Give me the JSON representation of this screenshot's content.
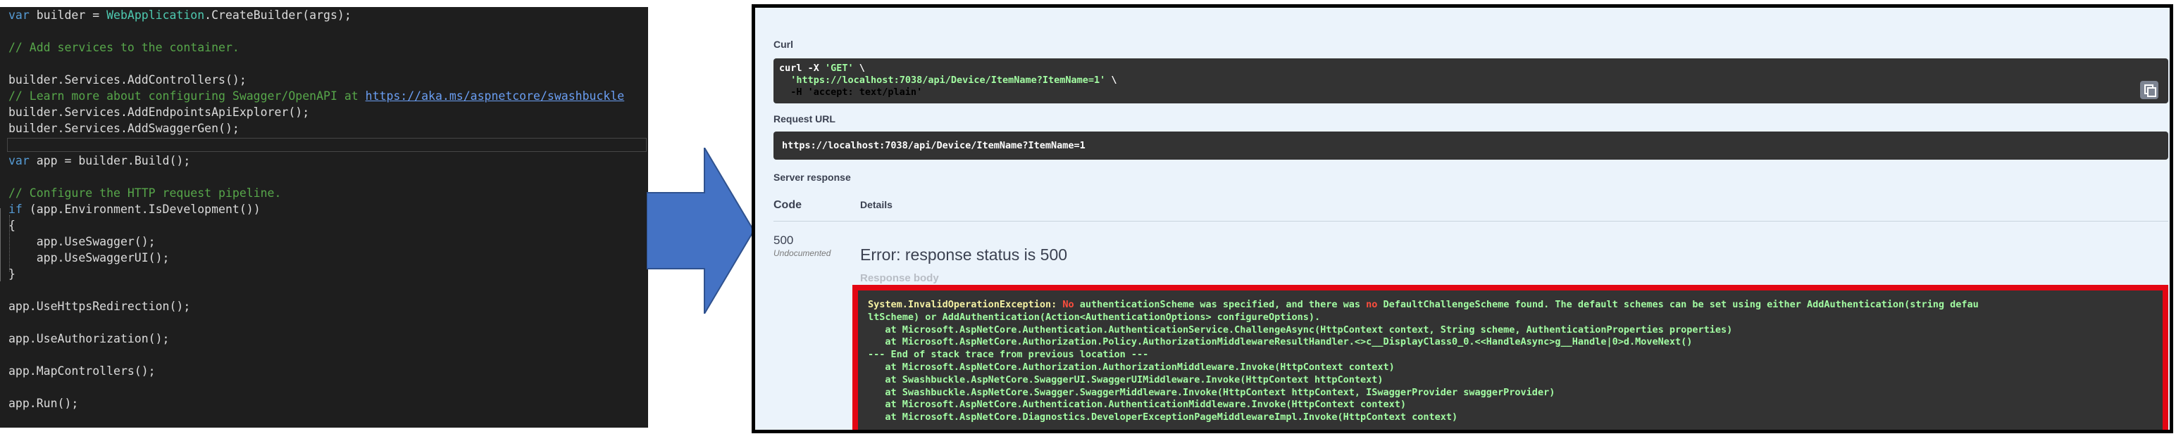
{
  "editor": {
    "lines": [
      [
        {
          "t": "var",
          "c": "kw"
        },
        {
          "t": " builder = ",
          "c": "pl"
        },
        {
          "t": "WebApplication",
          "c": "ty"
        },
        {
          "t": ".CreateBuilder(args);",
          "c": "pl"
        }
      ],
      [],
      [
        {
          "t": "// Add services to the container.",
          "c": "cm"
        }
      ],
      [],
      [
        {
          "t": "builder.Services.AddControllers();",
          "c": "pl"
        }
      ],
      [
        {
          "t": "// Learn more about configuring Swagger/OpenAPI at ",
          "c": "cm"
        },
        {
          "t": "https://aka.ms/aspnetcore/swashbuckle",
          "c": "lk"
        }
      ],
      [
        {
          "t": "builder.Services.AddEndpointsApiExplorer();",
          "c": "pl"
        }
      ],
      [
        {
          "t": "builder.Services.AddSwaggerGen();",
          "c": "pl"
        }
      ],
      [],
      [
        {
          "t": "var",
          "c": "kw"
        },
        {
          "t": " app = builder.Build();",
          "c": "pl"
        }
      ],
      [],
      [
        {
          "t": "// Configure the HTTP request pipeline.",
          "c": "cm"
        }
      ],
      [
        {
          "t": "if",
          "c": "kw"
        },
        {
          "t": " (app.Environment.IsDevelopment())",
          "c": "pl"
        }
      ],
      [
        {
          "t": "{",
          "c": "pl"
        }
      ],
      [
        {
          "t": "    app.UseSwagger();",
          "c": "pl"
        }
      ],
      [
        {
          "t": "    app.UseSwaggerUI();",
          "c": "pl"
        }
      ],
      [
        {
          "t": "}",
          "c": "pl"
        }
      ],
      [],
      [
        {
          "t": "app.UseHttpsRedirection();",
          "c": "pl"
        }
      ],
      [],
      [
        {
          "t": "app.UseAuthorization();",
          "c": "pl"
        }
      ],
      [],
      [
        {
          "t": "app.MapControllers();",
          "c": "pl"
        }
      ],
      [],
      [
        {
          "t": "app.Run();",
          "c": "pl"
        }
      ]
    ]
  },
  "swagger": {
    "curl_label": "Curl",
    "curl_command": "curl -X 'GET' \\\n  'https://localhost:7038/api/Device/ItemName?ItemName=1' \\\n  -H 'accept: text/plain'",
    "request_url_label": "Request URL",
    "request_url": "https://localhost:7038/api/Device/ItemName?ItemName=1",
    "server_response_label": "Server response",
    "col_code": "Code",
    "col_details": "Details",
    "status_code": "500",
    "status_note": "Undocumented",
    "error_message": "Error: response status is 500",
    "response_body_label": "Response body",
    "exception": {
      "type": "System.InvalidOperationException:",
      "segments": [
        {
          "t": " No",
          "c": "hl-red"
        },
        {
          "t": " authenticationScheme was specified, and there was ",
          "c": "tr"
        },
        {
          "t": "no",
          "c": "hl-red"
        },
        {
          "t": " DefaultChallengeScheme found. The default schemes can be set using either AddAuthentication(string defau\nltScheme) or AddAuthentication(Action<AuthenticationOptions> configureOptions).",
          "c": "tr"
        }
      ],
      "trace": [
        "   at Microsoft.AspNetCore.Authentication.AuthenticationService.ChallengeAsync(HttpContext context, String scheme, AuthenticationProperties properties)",
        "   at Microsoft.AspNetCore.Authorization.Policy.AuthorizationMiddlewareResultHandler.<>c__DisplayClass0_0.<<HandleAsync>g__Handle|0>d.MoveNext()",
        "--- End of stack trace from previous location ---",
        "   at Microsoft.AspNetCore.Authorization.AuthorizationMiddleware.Invoke(HttpContext context)",
        "   at Swashbuckle.AspNetCore.SwaggerUI.SwaggerUIMiddleware.Invoke(HttpContext httpContext)",
        "   at Swashbuckle.AspNetCore.Swagger.SwaggerMiddleware.Invoke(HttpContext httpContext, ISwaggerProvider swaggerProvider)",
        "   at Microsoft.AspNetCore.Authentication.AuthenticationMiddleware.Invoke(HttpContext context)",
        "   at Microsoft.AspNetCore.Diagnostics.DeveloperExceptionPageMiddlewareImpl.Invoke(HttpContext context)"
      ]
    }
  },
  "colors": {
    "arrow": "#4472c4",
    "highlight_frame": "#e30613",
    "editor_bg": "#1e1e1e",
    "swagger_bg": "#ebf3fb"
  },
  "icons": [
    "copy-icon",
    "right-arrow-icon"
  ]
}
